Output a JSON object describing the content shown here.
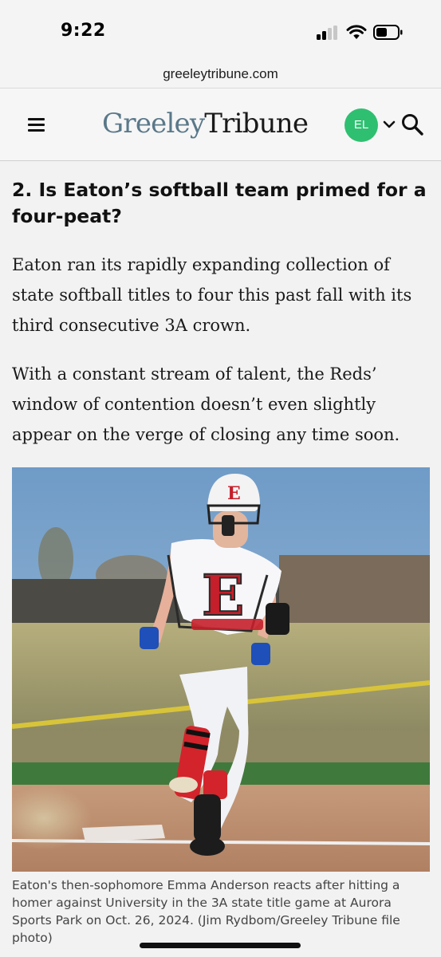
{
  "status_bar": {
    "time": "9:22",
    "icons": [
      "cellular-signal-icon",
      "wifi-icon",
      "battery-icon"
    ]
  },
  "browser": {
    "url": "greeleytribune.com"
  },
  "header": {
    "logo_part1": "Greeley",
    "logo_part2": "Tribune",
    "avatar_initials": "EL",
    "icons": [
      "hamburger-menu-icon",
      "chevron-down-icon",
      "search-icon"
    ],
    "colors": {
      "logo_blue": "#5a7889",
      "avatar_green": "#2fbf71"
    }
  },
  "article": {
    "headline": "2. Is Eaton’s softball team primed for a four-peat?",
    "paragraphs": [
      "Eaton ran its rapidly expanding collection of state softball titles to four this past fall with its third consecutive 3A crown.",
      "With a constant stream of talent, the Reds’ window of contention doesn’t even slightly appear on the verge of closing any time soon."
    ],
    "photo": {
      "caption": "Eaton's then-sophomore Emma Anderson reacts after hitting a homer against University in the 3A state title game at Aurora Sports Park on Oct. 26, 2024. (Jim Rydbom/Greeley Tribune file photo)"
    }
  }
}
